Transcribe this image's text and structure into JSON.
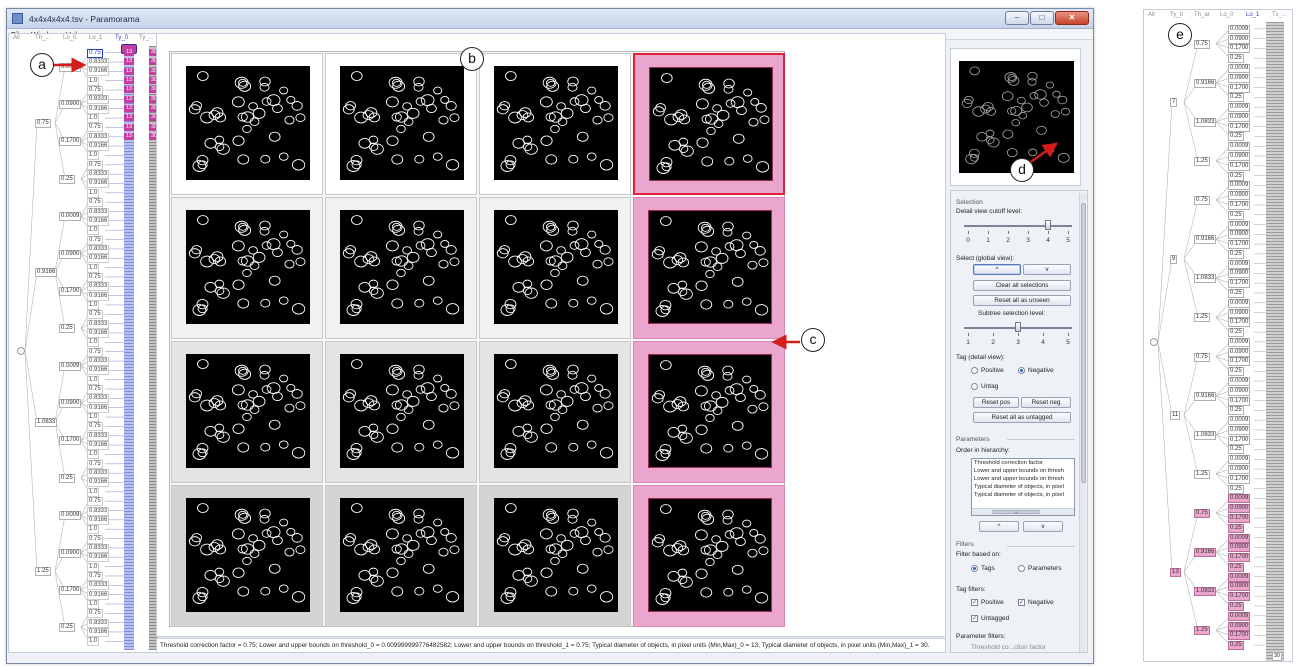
{
  "window": {
    "title": "4x4x4x4x4.tsv - Paramorama",
    "controls": {
      "minimize": "–",
      "maximize": "□",
      "close": "✕"
    }
  },
  "menu": [
    "File",
    "Window",
    "Help"
  ],
  "tree_left": {
    "headers": [
      "All",
      "Th_...",
      "Lo_0",
      "Lo_1",
      "Ty_0",
      "Ty_..."
    ],
    "selected_header": "Ty_0",
    "level1_values": [
      "0.75",
      "0.9166",
      "1.0833",
      "1.25"
    ],
    "level2_values": [
      "0.0009",
      "0.0900",
      "0.1700",
      "0.25"
    ],
    "level3_values": [
      "0.75",
      "0.8333",
      "0.9166",
      "1.0"
    ],
    "chip_ty": "13",
    "chip_tw": "30"
  },
  "tree_right": {
    "headers": [
      "All",
      "Ty_0",
      "Th_ar",
      "Lo_0",
      "Lo_1",
      "Tx_..."
    ],
    "selected_header": "Lo_1",
    "level1_values": [
      "7",
      "9",
      "11",
      "13"
    ],
    "level2_values": [
      "0.75",
      "0.9166",
      "1.0833",
      "1.25"
    ],
    "level3_values": [
      "0.0009",
      "0.0900",
      "0.1700",
      "0.25"
    ],
    "leaf": "30"
  },
  "callouts": [
    "a",
    "b",
    "c",
    "d",
    "e"
  ],
  "status_text": "Threshold correction factor = 0.75; Lower and upper bounds on threshold_0 = 0.009999999776482582; Lower and upper bounds on threshold_1 = 0.75; Typical diameter of objects, in pixel units (Min,Max)_0 = 13; Typical diameter of objects, in pixel units (Min,Max)_1 = 30.",
  "controls": {
    "selection_title": "Selection",
    "cutoff_label": "Detail view cutoff level:",
    "cutoff_ticks": [
      "0",
      "1",
      "2",
      "3",
      "4",
      "5"
    ],
    "cutoff_value": 4,
    "select_label": "Select (global view):",
    "up_button": "^",
    "down_button": "v",
    "clear_button": "Clear all selections",
    "reset_unseen_button": "Reset all as unseen",
    "subtree_label": "Subtree selection level:",
    "subtree_ticks": [
      "1",
      "2",
      "3",
      "4",
      "5"
    ],
    "subtree_value": 3,
    "tag_label": "Tag (detail view):",
    "positive": "Positive",
    "negative": "Negative",
    "untag": "Untag",
    "tag_selected": "Negative",
    "reset_pos": "Reset pos",
    "reset_neg": "Reset neg",
    "reset_untagged": "Reset all as untagged",
    "parameters_title": "Parameters",
    "order_label": "Order in hierarchy:",
    "order_items": [
      "Threshold correction factor",
      "Lower and upper bounds on thresh",
      "Lower and upper bounds on thresh",
      "Typical diameter of objects, in pixel",
      "Typical diameter of objects, in pixel"
    ],
    "list_scroll_mark": "III",
    "filters_title": "Filters",
    "filter_based_label": "Filter based on:",
    "tags_option": "Tags",
    "parameters_option": "Parameters",
    "filter_selected": "Tags",
    "tag_filters_label": "Tag filters:",
    "positive_check": "Positive",
    "negative_check": "Negative",
    "untagged_check": "Untagged",
    "param_filters_label": "Parameter filters:",
    "param_filter_item": "Threshold co...ction factor"
  },
  "grid": {
    "rows": 4,
    "cols": 4,
    "highlighted_column": 4,
    "active_cell": [
      1,
      4
    ]
  },
  "colors": {
    "highlight_pink": "#eaa6cc",
    "selection_red": "#e0223a",
    "accent_blue": "#2f3fd0",
    "tag_magenta": "#c43ea0"
  }
}
